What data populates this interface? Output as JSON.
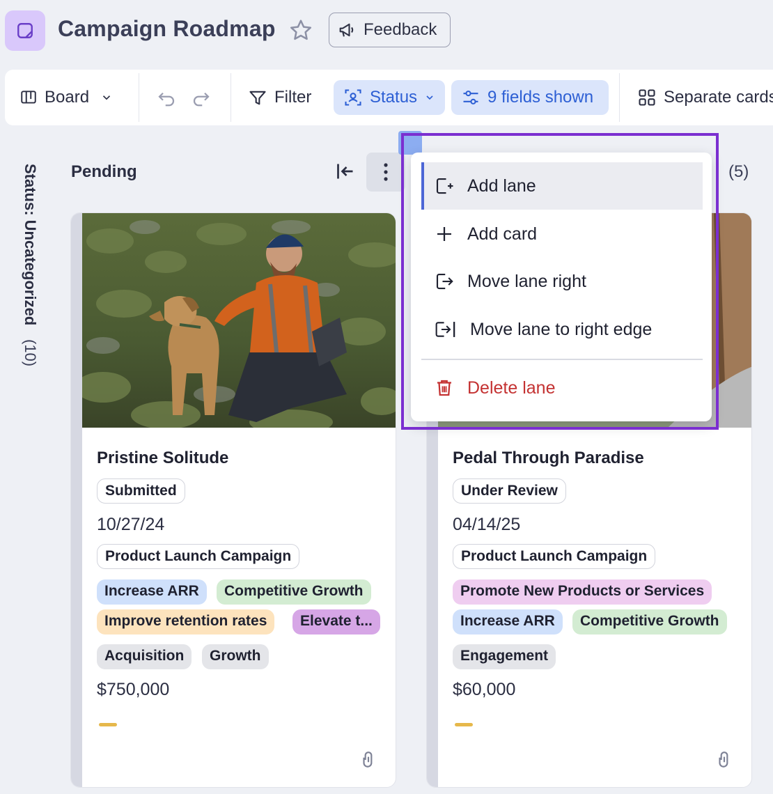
{
  "header": {
    "title": "Campaign Roadmap",
    "feedback_label": "Feedback"
  },
  "toolbar": {
    "view_label": "Board",
    "filter_label": "Filter",
    "group_label": "Status",
    "fields_label": "9 fields shown",
    "separate_label": "Separate cards"
  },
  "side_group": {
    "label": "Status: Uncategorized",
    "count": "(10)"
  },
  "lane": {
    "title": "Pending",
    "right_count": "(5)"
  },
  "cards": [
    {
      "title": "Pristine Solitude",
      "status": "Submitted",
      "date": "10/27/24",
      "campaign": "Product Launch Campaign",
      "goals": [
        "Increase ARR",
        "Competitive Growth",
        "Improve retention rates",
        "Elevate t..."
      ],
      "tags": [
        "Acquisition",
        "Growth"
      ],
      "amount": "$750,000"
    },
    {
      "title": "Pedal Through Paradise",
      "status": "Under Review",
      "date": "04/14/25",
      "campaign": "Product Launch Campaign",
      "goals": [
        "Promote New Products or Services",
        "Increase ARR",
        "Competitive Growth"
      ],
      "tags": [
        "Engagement"
      ],
      "amount": "$60,000"
    }
  ],
  "menu": {
    "add_lane": "Add lane",
    "add_card": "Add card",
    "move_right": "Move lane right",
    "move_right_edge": "Move lane to right edge",
    "delete_lane": "Delete lane"
  },
  "colors": {
    "accent_blue": "#2d5fd4",
    "highlight_purple": "#7b2fd0",
    "chip_blue": "#cfe0fb",
    "chip_green": "#d3ecd2",
    "chip_orange": "#fde3bd",
    "chip_purple": "#d6a6e6",
    "chip_pink": "#efcdf0",
    "chip_gray": "#e4e5e9",
    "delete_red": "#c43232"
  }
}
